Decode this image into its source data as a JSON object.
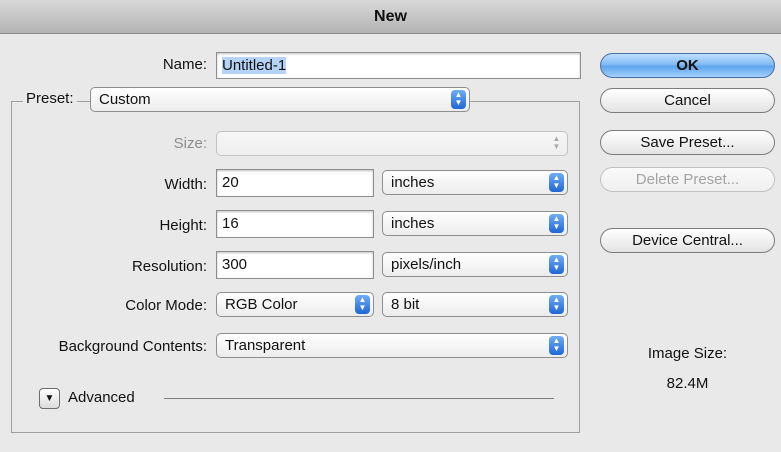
{
  "window": {
    "title": "New"
  },
  "form": {
    "name_label": "Name:",
    "name_value": "Untitled-1",
    "preset_label": "Preset:",
    "preset_value": "Custom",
    "size_label": "Size:",
    "size_value": "",
    "width_label": "Width:",
    "width_value": "20",
    "width_unit": "inches",
    "height_label": "Height:",
    "height_value": "16",
    "height_unit": "inches",
    "resolution_label": "Resolution:",
    "resolution_value": "300",
    "resolution_unit": "pixels/inch",
    "color_mode_label": "Color Mode:",
    "color_mode_value": "RGB Color",
    "bit_depth_value": "8 bit",
    "background_label": "Background Contents:",
    "background_value": "Transparent",
    "advanced_label": "Advanced"
  },
  "buttons": {
    "ok": "OK",
    "cancel": "Cancel",
    "save_preset": "Save Preset...",
    "delete_preset": "Delete Preset...",
    "device_central": "Device Central..."
  },
  "image_size": {
    "label": "Image Size:",
    "value": "82.4M"
  },
  "colors": {
    "accent": "#4a90e2",
    "disabled": "#a3a3a3"
  }
}
